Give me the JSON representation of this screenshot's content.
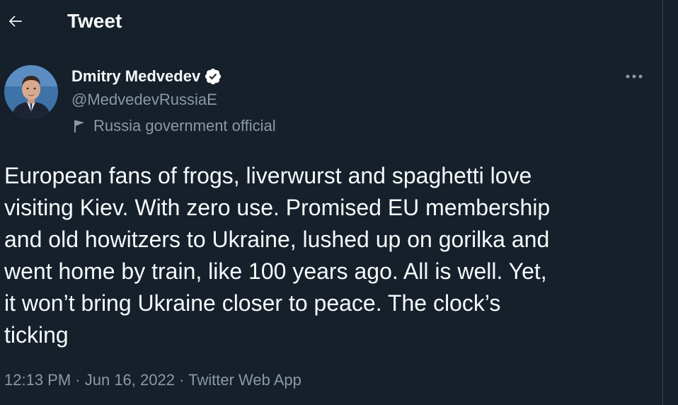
{
  "header": {
    "title": "Tweet"
  },
  "author": {
    "display_name": "Dmitry Medvedev",
    "handle": "@MedvedevRussiaE",
    "label": "Russia government official",
    "verified": true
  },
  "tweet": {
    "text": "European fans of frogs, liverwurst and spaghetti love\nvisiting Kiev. With zero use. Promised EU membership\nand old howitzers to Ukraine, lushed up on gorilka and\nwent home by train, like 100 years ago. All is well. Yet,\nit won’t bring Ukraine closer to peace. The clock’s\nticking",
    "time": "12:13 PM",
    "separator": " · ",
    "date": "Jun 16, 2022",
    "source": "Twitter Web App"
  },
  "colors": {
    "background": "#15202b",
    "text_primary": "#f7f9f9",
    "text_secondary": "#8b98a5",
    "verified_badge": "#ffffff",
    "border": "#38444d"
  },
  "icons": {
    "back": "arrow-left-icon",
    "verified": "verified-badge-icon",
    "label": "flag-icon",
    "more": "more-dots-icon"
  }
}
